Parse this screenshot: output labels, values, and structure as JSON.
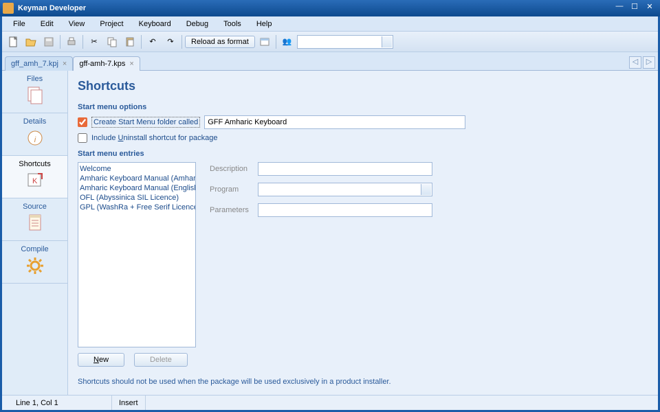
{
  "app": {
    "title": "Keyman Developer"
  },
  "menu": [
    "File",
    "Edit",
    "View",
    "Project",
    "Keyboard",
    "Debug",
    "Tools",
    "Help"
  ],
  "toolbar": {
    "reload": "Reload as format"
  },
  "tabs": [
    {
      "label": "gff_amh_7.kpj",
      "active": false
    },
    {
      "label": "gff-amh-7.kps",
      "active": true
    }
  ],
  "sidebar": [
    "Files",
    "Details",
    "Shortcuts",
    "Source",
    "Compile"
  ],
  "page": {
    "heading": "Shortcuts",
    "section1": "Start menu options",
    "chk1_label": "Create Start Menu folder called",
    "chk1_value": "GFF Amharic Keyboard",
    "chk2_prefix": "Include ",
    "chk2_underline": "U",
    "chk2_suffix": "ninstall shortcut for package",
    "section2": "Start menu entries",
    "entries": [
      "Welcome",
      "Amharic Keyboard Manual (Amharic)",
      "Amharic Keyboard Manual (English)",
      "OFL (Abyssinica SIL Licence)",
      "GPL (WashRa + Free Serif Licence)"
    ],
    "fields": {
      "desc": "Description",
      "prog": "Program",
      "params": "Parameters"
    },
    "buttons": {
      "new_u": "N",
      "new_rest": "ew",
      "delete": "Delete"
    },
    "hint": "Shortcuts should not be used when the package will be used exclusively in a product installer."
  },
  "status": {
    "pos": "Line 1, Col 1",
    "mode": "Insert"
  }
}
